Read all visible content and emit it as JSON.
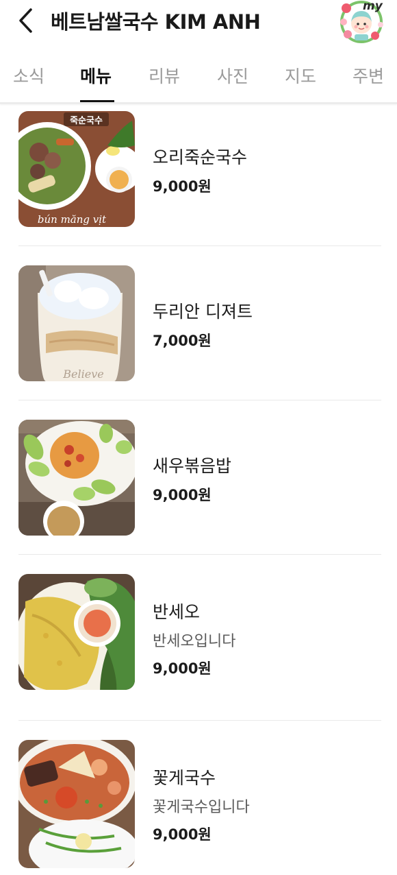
{
  "header": {
    "title": "베트남쌀국수 KIM ANH",
    "back_icon": "chevron-left-icon",
    "avatar_label": "my"
  },
  "tabs": [
    {
      "label": "소식",
      "active": false
    },
    {
      "label": "메뉴",
      "active": true
    },
    {
      "label": "리뷰",
      "active": false
    },
    {
      "label": "사진",
      "active": false
    },
    {
      "label": "지도",
      "active": false
    },
    {
      "label": "주변",
      "active": false
    }
  ],
  "menu": [
    {
      "name": "오리죽순국수",
      "description": "",
      "price": "9,000원",
      "photo_caption_top": "죽순국수",
      "photo_caption_bottom": "bún măng vịt"
    },
    {
      "name": "두리안 디져트",
      "description": "",
      "price": "7,000원",
      "photo_caption_bottom": "Believe"
    },
    {
      "name": "새우볶음밥",
      "description": "",
      "price": "9,000원"
    },
    {
      "name": "반세오",
      "description": "반세오입니다",
      "price": "9,000원"
    },
    {
      "name": "꽃게국수",
      "description": "꽃게국수입니다",
      "price": "9,000원"
    }
  ],
  "colors": {
    "active_tab": "#111111",
    "inactive_tab": "#9a9a9a",
    "divider": "#e9e9e9"
  }
}
